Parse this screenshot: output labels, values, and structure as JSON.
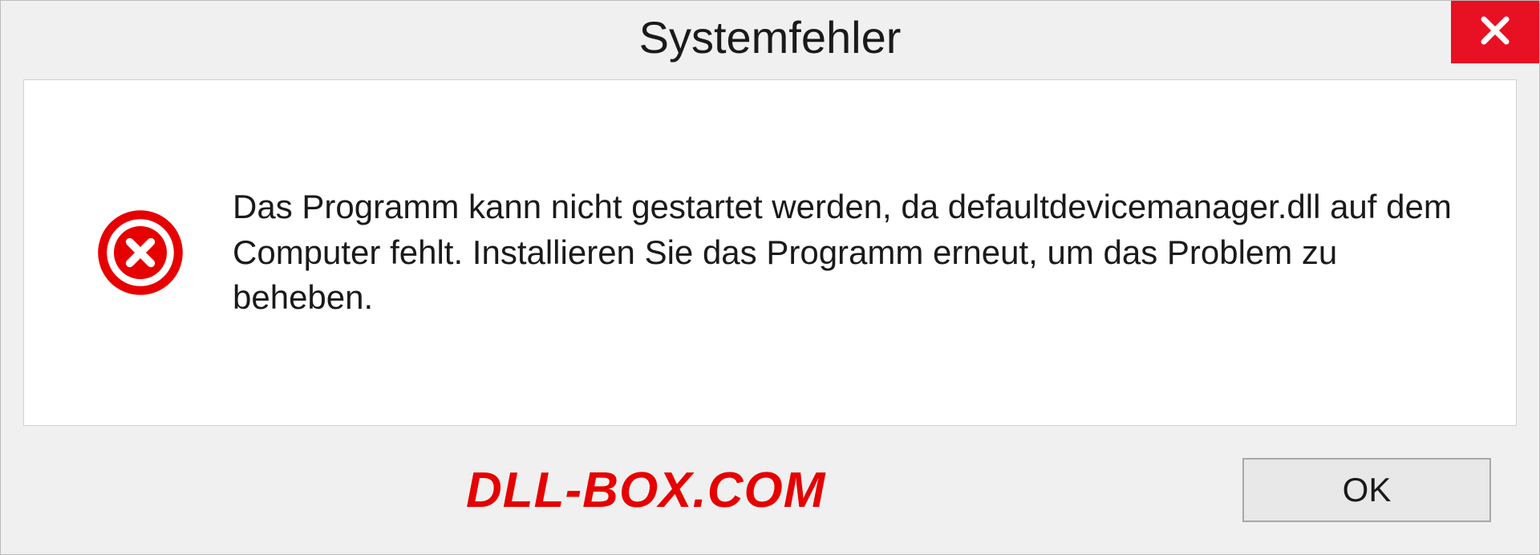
{
  "dialog": {
    "title": "Systemfehler",
    "message": "Das Programm kann nicht gestartet werden, da defaultdevicemanager.dll auf dem Computer fehlt. Installieren Sie das Programm erneut, um das Problem zu beheben.",
    "ok_label": "OK"
  },
  "watermark": "DLL-BOX.COM"
}
